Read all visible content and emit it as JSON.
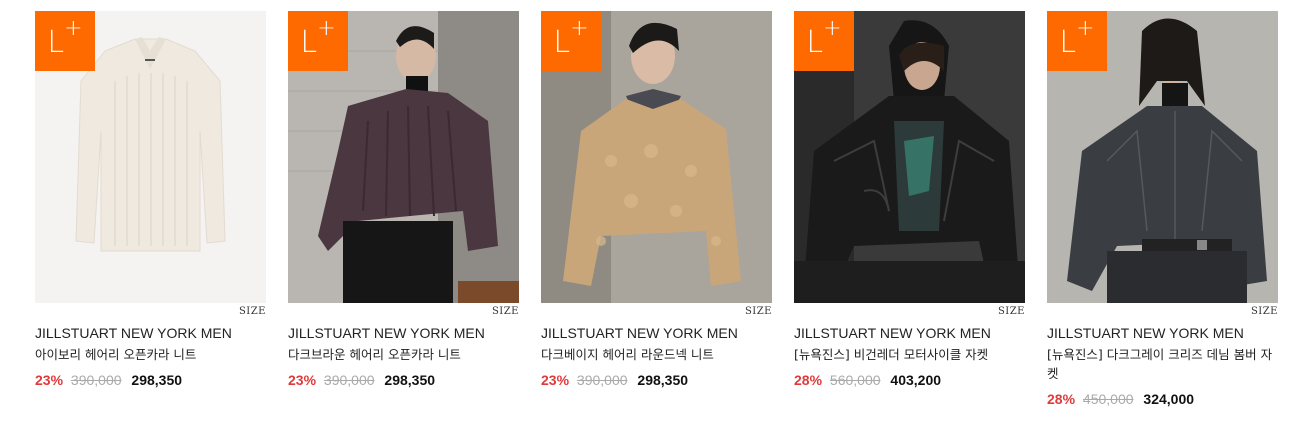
{
  "badge_color": "#ff6a00",
  "badge_label": "L+",
  "products": [
    {
      "brand": "JILLSTUART NEW YORK MEN",
      "name": "아이보리 헤어리 오픈카라 니트",
      "discount": "23%",
      "original_price": "390,000",
      "sale_price": "298,350",
      "size_label": "SIZE",
      "image": "ivory-collar-knit-sweater"
    },
    {
      "brand": "JILLSTUART NEW YORK MEN",
      "name": "다크브라운 헤어리 오픈카라 니트",
      "discount": "23%",
      "original_price": "390,000",
      "sale_price": "298,350",
      "size_label": "SIZE",
      "image": "model-dark-brown-collar-knit"
    },
    {
      "brand": "JILLSTUART NEW YORK MEN",
      "name": "다크베이지 헤어리 라운드넥 니트",
      "discount": "23%",
      "original_price": "390,000",
      "sale_price": "298,350",
      "size_label": "SIZE",
      "image": "model-beige-round-neck-knit"
    },
    {
      "brand": "JILLSTUART NEW YORK MEN",
      "name": "[뉴욕진스] 비건레더 모터사이클 자켓",
      "discount": "28%",
      "original_price": "560,000",
      "sale_price": "403,200",
      "size_label": "SIZE",
      "image": "model-black-leather-jacket"
    },
    {
      "brand": "JILLSTUART NEW YORK MEN",
      "name": "[뉴욕진스] 다크그레이 크리즈 데님 봄버 자켓",
      "discount": "28%",
      "original_price": "450,000",
      "sale_price": "324,000",
      "size_label": "SIZE",
      "image": "model-dark-grey-denim-bomber"
    }
  ]
}
